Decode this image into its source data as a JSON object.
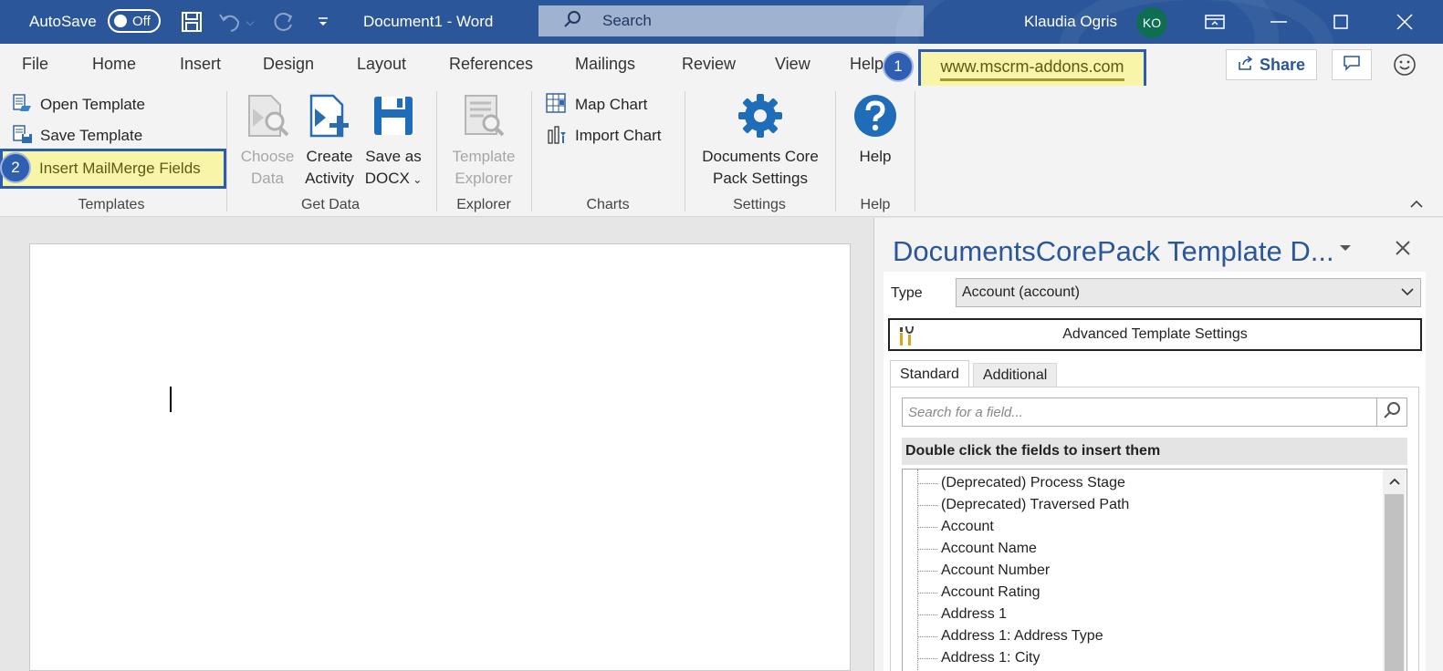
{
  "titlebar": {
    "autosave_label": "AutoSave",
    "autosave_state": "Off",
    "document_title": "Document1  -  Word",
    "search_placeholder": "Search",
    "user_name": "Klaudia Ogris",
    "user_initials": "KO"
  },
  "tabs": [
    "File",
    "Home",
    "Insert",
    "Design",
    "Layout",
    "References",
    "Mailings",
    "Review",
    "View",
    "Help"
  ],
  "callouts": {
    "badge1": "1",
    "badge2": "2",
    "url": "www.mscrm-addons.com"
  },
  "toolbar_right": {
    "share_label": "Share"
  },
  "ribbon": {
    "templates": {
      "open_template": "Open Template",
      "save_template": "Save Template",
      "insert_mailmerge": "Insert MailMerge Fields",
      "label": "Templates"
    },
    "get_data": {
      "choose_data_1": "Choose",
      "choose_data_2": "Data",
      "create_activity_1": "Create",
      "create_activity_2": "Activity",
      "save_docx_1": "Save as",
      "save_docx_2": "DOCX",
      "label": "Get Data"
    },
    "explorer": {
      "template_explorer_1": "Template",
      "template_explorer_2": "Explorer",
      "label": "Explorer"
    },
    "charts": {
      "map_chart": "Map Chart",
      "import_chart": "Import Chart",
      "label": "Charts"
    },
    "settings": {
      "dcp_settings_1": "Documents Core",
      "dcp_settings_2": "Pack Settings",
      "label": "Settings"
    },
    "help": {
      "help_button": "Help",
      "label": "Help"
    }
  },
  "pane": {
    "title": "DocumentsCorePack Template D...",
    "type_label": "Type",
    "type_value": "Account (account)",
    "advanced_settings": "Advanced Template Settings",
    "tab_standard": "Standard",
    "tab_additional": "Additional",
    "field_search_placeholder": "Search for a field...",
    "hint": "Double click the fields to insert them",
    "fields": [
      "(Deprecated) Process Stage",
      "(Deprecated) Traversed Path",
      "Account",
      "Account Name",
      "Account Number",
      "Account Rating",
      "Address 1",
      "Address 1: Address Type",
      "Address 1: City"
    ]
  }
}
